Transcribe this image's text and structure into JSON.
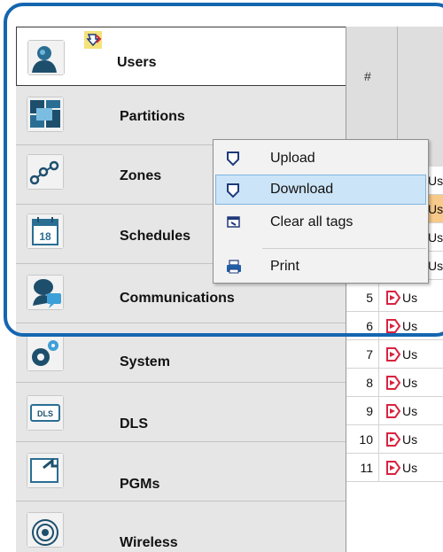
{
  "nav": {
    "items": [
      {
        "label": "Users",
        "icon": "users-icon",
        "selected": true
      },
      {
        "label": "Partitions",
        "icon": "partitions-icon",
        "selected": false
      },
      {
        "label": "Zones",
        "icon": "zones-icon",
        "selected": false
      },
      {
        "label": "Schedules",
        "icon": "schedules-icon",
        "selected": false,
        "calendar_day": "18"
      },
      {
        "label": "Communications",
        "icon": "communications-icon",
        "selected": false
      },
      {
        "label": "System",
        "icon": "system-icon",
        "selected": false
      },
      {
        "label": "DLS",
        "icon": "dls-icon",
        "selected": false,
        "badge": "DLS"
      },
      {
        "label": "PGMs",
        "icon": "pgms-icon",
        "selected": false
      },
      {
        "label": "Wireless",
        "icon": "wireless-icon",
        "selected": false
      }
    ],
    "sync_badge_icon": "sync-badge-icon"
  },
  "grid": {
    "header": {
      "hash": "#"
    },
    "hidden_rows": [
      "Us",
      "Us",
      "Us",
      "Us"
    ],
    "rows": [
      {
        "num": "5",
        "text": "Us"
      },
      {
        "num": "6",
        "text": "Us"
      },
      {
        "num": "7",
        "text": "Us"
      },
      {
        "num": "8",
        "text": "Us"
      },
      {
        "num": "9",
        "text": "Us"
      },
      {
        "num": "10",
        "text": "Us"
      },
      {
        "num": "11",
        "text": "Us"
      }
    ],
    "row_icon": "user-tag-icon"
  },
  "context_menu": {
    "items": [
      {
        "label": "Upload",
        "icon": "upload-icon"
      },
      {
        "label": "Download",
        "icon": "download-icon",
        "highlighted": true
      },
      {
        "label": "Clear all tags",
        "icon": "clear-tags-icon"
      },
      {
        "label": "Print",
        "icon": "print-icon"
      }
    ]
  },
  "colors": {
    "callout_border": "#1466b0",
    "menu_highlight": "#cce4f7",
    "highlighted_row": "#f7c98a",
    "tag_red": "#d9233f"
  }
}
